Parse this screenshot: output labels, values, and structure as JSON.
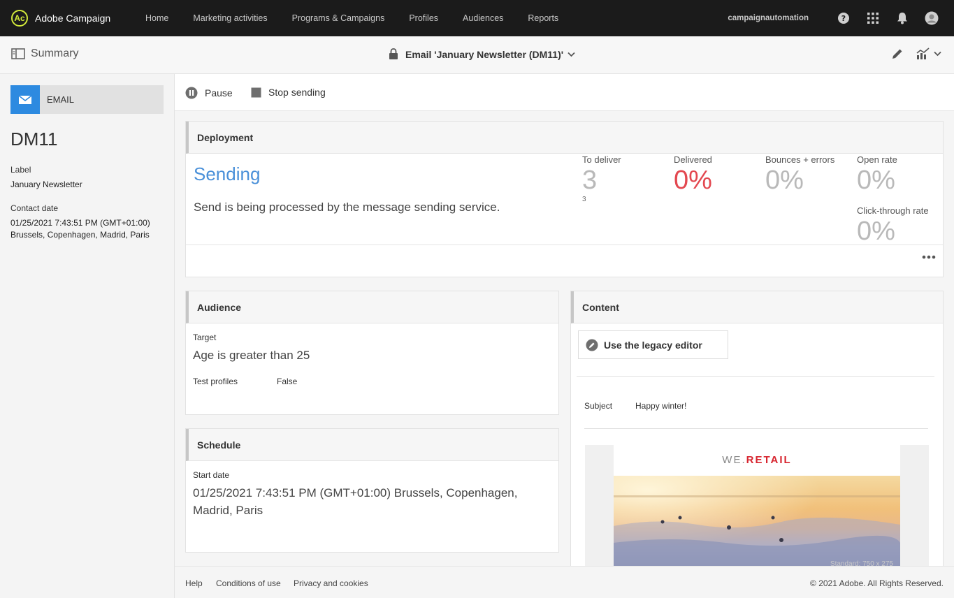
{
  "app": {
    "name": "Adobe Campaign",
    "logo_glyph": "Ac"
  },
  "nav": [
    {
      "id": "home",
      "label": "Home"
    },
    {
      "id": "marketing-activities",
      "label": "Marketing activities"
    },
    {
      "id": "programs-campaigns",
      "label": "Programs & Campaigns"
    },
    {
      "id": "profiles",
      "label": "Profiles"
    },
    {
      "id": "audiences",
      "label": "Audiences"
    },
    {
      "id": "reports",
      "label": "Reports"
    }
  ],
  "user": {
    "name": "campaignautomation"
  },
  "header": {
    "summary_label": "Summary",
    "title": "Email 'January Newsletter (DM11)'"
  },
  "left": {
    "channel": "EMAIL",
    "id": "DM11",
    "label_caption": "Label",
    "label_value": "January Newsletter",
    "contact_caption": "Contact date",
    "contact_value_1": "01/25/2021 7:43:51 PM (GMT+01:00)",
    "contact_value_2": "Brussels, Copenhagen, Madrid, Paris"
  },
  "actions": {
    "pause": "Pause",
    "stop": "Stop sending"
  },
  "deployment": {
    "title": "Deployment",
    "status": "Sending",
    "description": "Send is being processed by the message sending service.",
    "kpis": {
      "to_deliver": {
        "label": "To deliver",
        "value": "3",
        "sub": "3"
      },
      "delivered": {
        "label": "Delivered",
        "value": "0%"
      },
      "bounces": {
        "label": "Bounces + errors",
        "value": "0%"
      },
      "open_rate": {
        "label": "Open rate",
        "value": "0%"
      },
      "ctr": {
        "label": "Click-through rate",
        "value": "0%"
      }
    }
  },
  "audience": {
    "title": "Audience",
    "target_caption": "Target",
    "target_value": "Age is greater than 25",
    "test_profiles_caption": "Test profiles",
    "test_profiles_value": "False"
  },
  "schedule": {
    "title": "Schedule",
    "start_caption": "Start date",
    "start_value_1": "01/25/2021 7:43:51 PM (GMT+01:00) Brussels, Copenhagen,",
    "start_value_2": "Madrid, Paris"
  },
  "content": {
    "title": "Content",
    "legacy_button": "Use the legacy editor",
    "subject_caption": "Subject",
    "subject_value": "Happy winter!",
    "email_brand_1": "WE.",
    "email_brand_2": "RETAIL",
    "email_dim": "Standard: 750 x 275"
  },
  "footer": {
    "help": "Help",
    "conditions": "Conditions of use",
    "privacy": "Privacy and cookies",
    "copyright": "© 2021 Adobe. All Rights Reserved."
  },
  "colors": {
    "accent": "#2d8ae0",
    "status_blue": "#4a90d9",
    "alert_red": "#e34850",
    "topbar": "#1b1b1b"
  }
}
